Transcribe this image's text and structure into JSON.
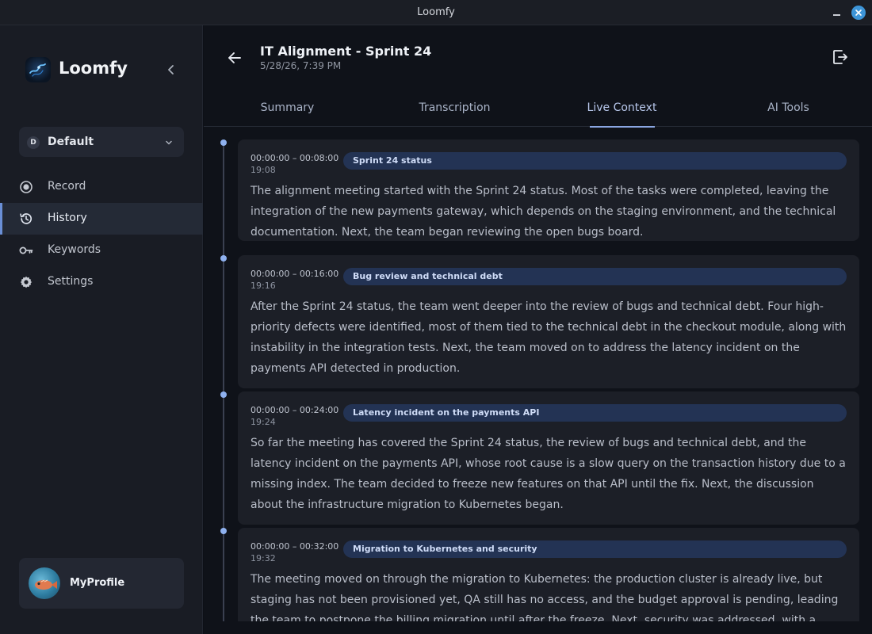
{
  "window": {
    "title": "Loomfy"
  },
  "sidebar": {
    "brand": "Loomfy",
    "workspace": {
      "initial": "D",
      "label": "Default"
    },
    "items": [
      {
        "label": "Record",
        "icon": "record-icon"
      },
      {
        "label": "History",
        "icon": "history-icon"
      },
      {
        "label": "Keywords",
        "icon": "key-icon"
      },
      {
        "label": "Settings",
        "icon": "gear-icon"
      }
    ],
    "active_item": "History",
    "profile": {
      "name": "MyProfile"
    }
  },
  "header": {
    "title": "IT Alignment - Sprint 24",
    "date": "5/28/26, 7:39 PM"
  },
  "tabs": [
    {
      "label": "Summary"
    },
    {
      "label": "Transcription"
    },
    {
      "label": "Live Context"
    },
    {
      "label": "AI Tools"
    }
  ],
  "active_tab": "Live Context",
  "entries": [
    {
      "range": "00:00:00 – 00:08:00",
      "time": "19:08",
      "topic": "Sprint 24 status",
      "text": "The alignment meeting started with the Sprint 24 status. Most of the tasks were completed, leaving the integration of the new payments gateway, which depends on the staging environment, and the technical documentation. Next, the team began reviewing the open bugs board."
    },
    {
      "range": "00:00:00 – 00:16:00",
      "time": "19:16",
      "topic": "Bug review and technical debt",
      "text": "After the Sprint 24 status, the team went deeper into the review of bugs and technical debt. Four high-priority defects were identified, most of them tied to the technical debt in the checkout module, along with instability in the integration tests. Next, the team moved on to address the latency incident on the payments API detected in production."
    },
    {
      "range": "00:00:00 – 00:24:00",
      "time": "19:24",
      "topic": "Latency incident on the payments API",
      "text": "So far the meeting has covered the Sprint 24 status, the review of bugs and technical debt, and the latency incident on the payments API, whose root cause is a slow query on the transaction history due to a missing index. The team decided to freeze new features on that API until the fix. Next, the discussion about the infrastructure migration to Kubernetes began."
    },
    {
      "range": "00:00:00 – 00:32:00",
      "time": "19:32",
      "topic": "Migration to Kubernetes and security",
      "text": "The meeting moved on through the migration to Kubernetes: the production cluster is already live, but staging has not been provisioned yet, QA still has no access, and the budget approval is pending, leading the team to postpone the billing migration until after the freeze. Next, security was addressed, with a critical"
    }
  ]
}
